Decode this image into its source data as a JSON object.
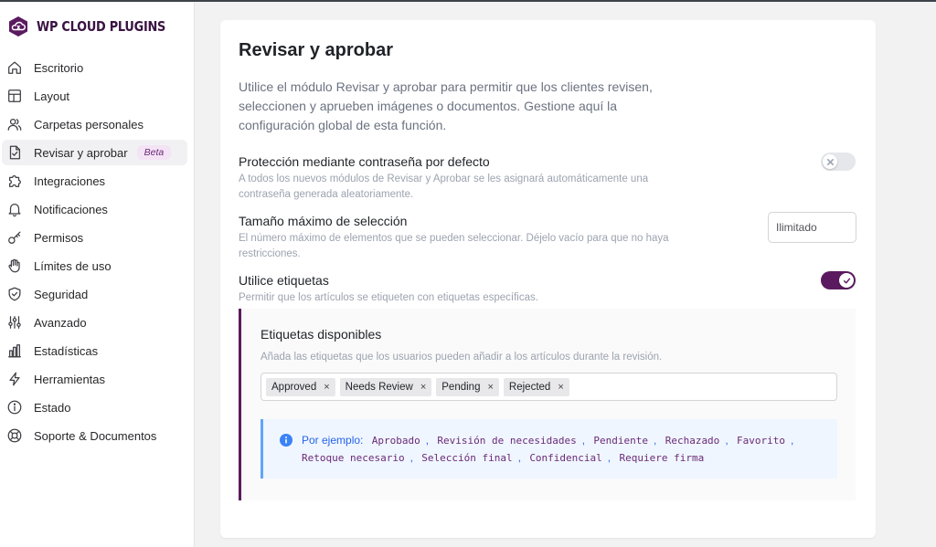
{
  "brand": {
    "name": "WP CLOUD PLUGINS"
  },
  "sidebar": {
    "items": [
      {
        "label": "Escritorio",
        "icon": "home-icon"
      },
      {
        "label": "Layout",
        "icon": "layout-icon"
      },
      {
        "label": "Carpetas personales",
        "icon": "users-icon"
      },
      {
        "label": "Revisar y aprobar",
        "icon": "file-check-icon",
        "badge": "Beta",
        "active": true
      },
      {
        "label": "Integraciones",
        "icon": "puzzle-icon"
      },
      {
        "label": "Notificaciones",
        "icon": "bell-icon"
      },
      {
        "label": "Permisos",
        "icon": "key-icon"
      },
      {
        "label": "Límites de uso",
        "icon": "hand-icon"
      },
      {
        "label": "Seguridad",
        "icon": "shield-icon"
      },
      {
        "label": "Avanzado",
        "icon": "sliders-icon"
      },
      {
        "label": "Estadísticas",
        "icon": "bar-chart-icon"
      },
      {
        "label": "Herramientas",
        "icon": "bolt-icon"
      },
      {
        "label": "Estado",
        "icon": "info-icon"
      },
      {
        "label": "Soporte & Documentos",
        "icon": "lifebuoy-icon"
      }
    ]
  },
  "main": {
    "title": "Revisar y aprobar",
    "intro": "Utilice el módulo Revisar y aprobar para permitir que los clientes revisen, seleccionen y aprueben imágenes o documentos. Gestione aquí la configuración global de esta función.",
    "settings": {
      "password": {
        "title": "Protección mediante contraseña por defecto",
        "desc": "A todos los nuevos módulos de Revisar y Aprobar se les asignará automáticamente una contraseña generada aleatoriamente.",
        "enabled": false
      },
      "max_selection": {
        "title": "Tamaño máximo de selección",
        "desc": "El número máximo de elementos que se pueden seleccionar. Déjelo vacío para que no haya restricciones.",
        "value": "",
        "placeholder": "Ilimitado"
      },
      "tags": {
        "title": "Utilice etiquetas",
        "desc": "Permitir que los artículos se etiqueten con etiquetas específicas.",
        "enabled": true
      }
    },
    "tags_panel": {
      "title": "Etiquetas disponibles",
      "desc": "Añada las etiquetas que los usuarios pueden añadir a los artículos durante la revisión.",
      "tags": [
        "Approved",
        "Needs Review",
        "Pending",
        "Rejected"
      ],
      "remove_glyph": "×",
      "notice": {
        "label": "Por ejemplo:",
        "examples": [
          "Aprobado",
          "Revisión de necesidades",
          "Pendiente",
          "Rechazado",
          "Favorito",
          "Retoque necesario",
          "Selección final",
          "Confidencial",
          "Requiere firma"
        ],
        "separator": ","
      }
    }
  },
  "colors": {
    "brand": "#5b1a5f",
    "accent_light": "#f3e3f5",
    "info": "#2563eb",
    "info_bg": "#eff6ff"
  }
}
